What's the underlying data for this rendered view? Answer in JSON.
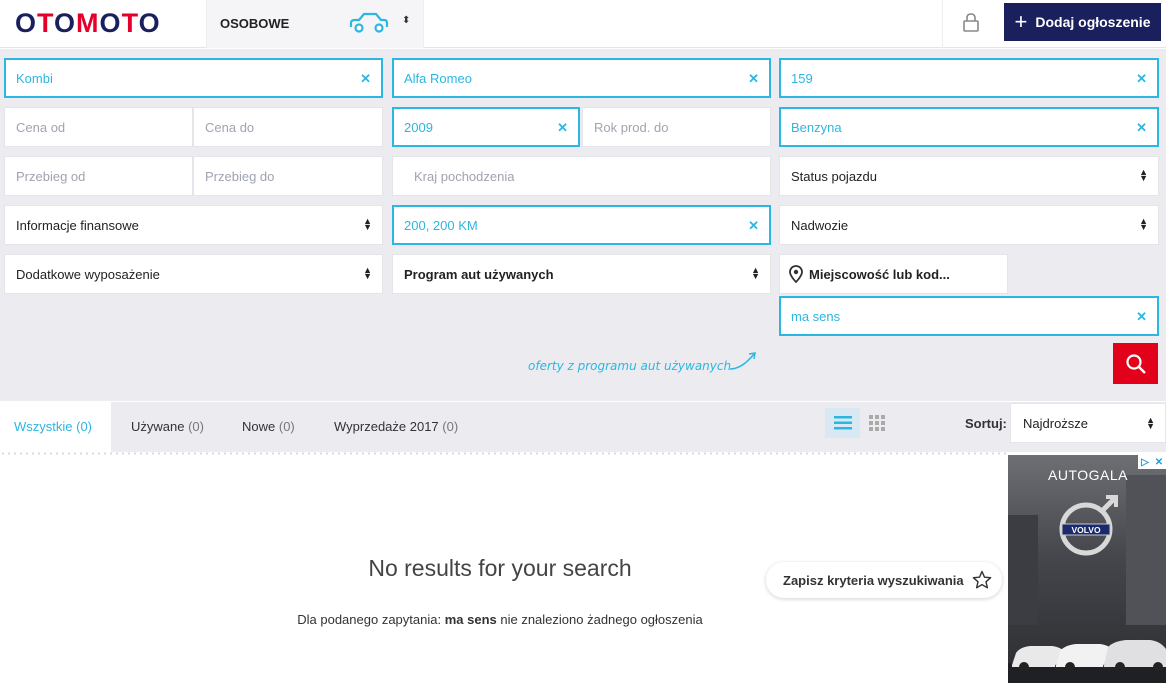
{
  "header": {
    "logo_text": "OTOMOTO",
    "category_label": "OSOBOWE",
    "add_listing_label": "Dodaj ogłoszenie"
  },
  "filters": {
    "body_type": "Kombi",
    "make": "Alfa Romeo",
    "model": "159",
    "price_from_placeholder": "Cena od",
    "price_to_placeholder": "Cena do",
    "year_from": "2009",
    "year_to_placeholder": "Rok prod. do",
    "fuel": "Benzyna",
    "mileage_from_placeholder": "Przebieg od",
    "mileage_to_placeholder": "Przebieg do",
    "origin_placeholder": "Kraj pochodzenia",
    "vehicle_status": "Status pojazdu",
    "financial_info": "Informacje finansowe",
    "power": "200, 200 KM",
    "bodywork": "Nadwozie",
    "extra_equipment": "Dodatkowe wyposażenie",
    "used_program": "Program aut używanych",
    "location_placeholder": "Miejscowość lub kod...",
    "phrase": "ma sens",
    "hint": "oferty z programu aut używanych"
  },
  "tabs": [
    {
      "label": "Wszystkie",
      "count": "(0)"
    },
    {
      "label": "Używane",
      "count": "(0)"
    },
    {
      "label": "Nowe",
      "count": "(0)"
    },
    {
      "label": "Wyprzedaże 2017",
      "count": "(0)"
    }
  ],
  "sort": {
    "label": "Sortuj:",
    "value": "Najdroższe"
  },
  "results": {
    "heading": "No results for your search",
    "sub_prefix": "Dla podanego zapytania: ",
    "sub_query": "ma sens",
    "sub_suffix": " nie znaleziono żadnego ogłoszenia"
  },
  "save_search_label": "Zapisz kryteria wyszukiwania",
  "ad": {
    "title": "AUTOGALA",
    "brand": "VOLVO"
  },
  "colors": {
    "brand_red": "#e4002b",
    "brand_navy": "#1a1f5e",
    "accent_blue": "#2cb7e2",
    "search_red": "#e2001a"
  }
}
